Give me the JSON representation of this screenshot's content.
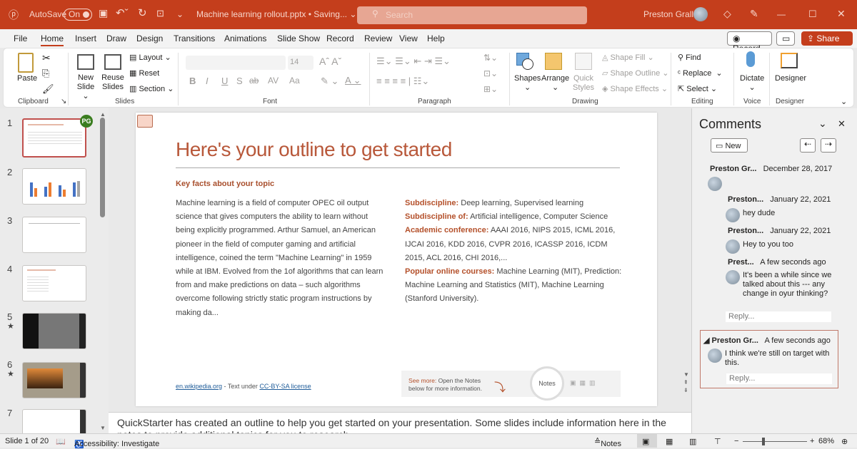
{
  "titlebar": {
    "autosave_label": "AutoSave",
    "autosave_state": "On",
    "filename": "Machine learning rollout.pptx • Saving... ⌄",
    "search_placeholder": "Search",
    "user": "Preston Gralla",
    "accent": "#c43e1c"
  },
  "tabs": [
    "File",
    "Home",
    "Insert",
    "Draw",
    "Design",
    "Transitions",
    "Animations",
    "Slide Show",
    "Record",
    "Review",
    "View",
    "Help"
  ],
  "tab_actions": {
    "record": "Record",
    "share": "Share"
  },
  "ribbon": {
    "clipboard": {
      "paste": "Paste",
      "label": "Clipboard"
    },
    "slides": {
      "new_slide": "New Slide ⌄",
      "reuse": "Reuse Slides",
      "layout": "Layout ⌄",
      "reset": "Reset",
      "section": "Section ⌄",
      "label": "Slides"
    },
    "font": {
      "size": "14",
      "label": "Font",
      "bold": "B",
      "italic": "I",
      "underline": "U",
      "shadow": "S",
      "strike": "ab",
      "spacing": "AV",
      "case": "Aa"
    },
    "paragraph": {
      "label": "Paragraph"
    },
    "drawing": {
      "shapes": "Shapes",
      "arrange": "Arrange",
      "quick_styles": "Quick Styles",
      "shape_fill": "Shape Fill ⌄",
      "shape_outline": "Shape Outline ⌄",
      "shape_effects": "Shape Effects ⌄",
      "label": "Drawing"
    },
    "editing": {
      "find": "Find",
      "replace": "Replace",
      "select": "Select ⌄",
      "label": "Editing"
    },
    "voice": {
      "dictate": "Dictate",
      "label": "Voice"
    },
    "designer": {
      "designer": "Designer",
      "label": "Designer"
    }
  },
  "thumbnails": [
    {
      "num": "1",
      "badge": "PG"
    },
    {
      "num": "2"
    },
    {
      "num": "3"
    },
    {
      "num": "4"
    },
    {
      "num": "5",
      "star": "★"
    },
    {
      "num": "6",
      "star": "★"
    },
    {
      "num": "7"
    }
  ],
  "slide": {
    "title": "Here's your outline to get started",
    "heading": "Key facts about your topic",
    "body": "Machine learning is a field of computer OPEC oil output science that gives computers the ability to learn without being explicitly programmed. Arthur Samuel, an American pioneer in the field of computer gaming and artificial intelligence, coined the term \"Machine Learning\" in 1959 while at IBM. Evolved from the 1of algorithms that can learn from and make predictions on data – such algorithms overcome following strictly static program instructions by making da...",
    "facts": [
      {
        "label": "Subdiscipline:",
        "value": " Deep learning, Supervised learning"
      },
      {
        "label": "Subdiscipline of:",
        "value": " Artificial intelligence, Computer Science"
      },
      {
        "label": "Academic conference:",
        "value": " AAAI 2016, NIPS 2015, ICML 2016, IJCAI 2016, KDD 2016, CVPR 2016, ICASSP 2016, ICDM 2015, ACL 2016, CHI 2016,..."
      },
      {
        "label": "Popular online courses:",
        "value": " Machine Learning (MIT), Prediction: Machine Learning and Statistics (MIT), Machine Learning (Stanford University)."
      }
    ],
    "source_link": "en.wikipedia.org",
    "source_mid": " - Text under ",
    "license_link": "CC-BY-SA license",
    "seemore_label": "See more:",
    "seemore_text": " Open the Notes below for more information.",
    "notes_pill": "Notes"
  },
  "notes": "QuickStarter has created an outline to help you get started on your presentation. Some slides include information here in the notes to provide additional topics for you to research.",
  "comments": {
    "title": "Comments",
    "new": "New",
    "items": [
      {
        "author": "Preston Gr...",
        "date": "December 28, 2017",
        "text": ""
      },
      {
        "author": "Preston...",
        "date": "January 22, 2021",
        "text": "hey dude"
      },
      {
        "author": "Preston...",
        "date": "January 22, 2021",
        "text": "Hey to you too"
      },
      {
        "author": "Prest...",
        "date": "A few seconds ago",
        "text": "It's been a while since we talked about this --- any change in oyur thinking?"
      },
      {
        "author": "Preston Gr...",
        "date": "A few seconds ago",
        "text": "I think we're still on target with this."
      }
    ],
    "reply_placeholder": "Reply..."
  },
  "status": {
    "slide": "Slide 1 of 20",
    "accessibility": "Accessibility: Investigate",
    "notes": "Notes",
    "zoom": "68%",
    "zoom_percent": 68
  }
}
